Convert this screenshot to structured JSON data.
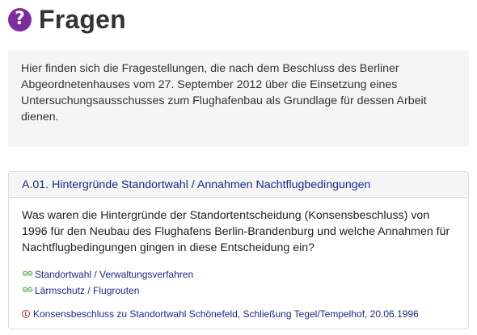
{
  "page": {
    "title": "Fragen",
    "icon": "question-circle-icon",
    "accent": "#7b2da0"
  },
  "intro": {
    "text": "Hier finden sich die Fragestellungen, die nach dem Beschluss des Berliner Abgeordnetenhauses vom 27. September 2012 über die Einsetzung eines Untersuchungsausschusses zum Flughafenbau als Grundlage für dessen Arbeit dienen."
  },
  "question": {
    "heading": "A.01. Hintergründe Standortwahl / Annahmen Nachtflugbedingungen",
    "text": "Was waren die Hintergründe der Standortentscheidung (Konsensbeschluss) von 1996 für den Neubau des Flughafens Berlin-Brandenburg und welche Annahmen für Nachtflugbedingungen gingen in diese Entscheidung ein?",
    "tags": [
      {
        "label": "Standortwahl / Verwaltungsverfahren",
        "icon": "gears-icon"
      },
      {
        "label": "Lärmschutz / Flugrouten",
        "icon": "gears-icon"
      }
    ],
    "document": {
      "label": "Konsensbeschluss zu Standortwahl Schönefeld, Schließung Tegel/Tempelhof, 20.06.1996",
      "icon": "clock-icon"
    }
  }
}
